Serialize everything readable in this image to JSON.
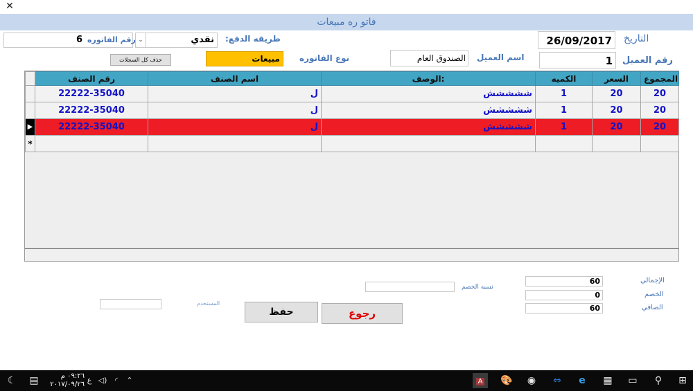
{
  "window": {
    "title": "فاتو ره مبيعات",
    "close_glyph": "✕"
  },
  "form": {
    "date_label": "التاريخ",
    "date_value": "26/09/2017",
    "payment_label": "طريقه الدفع:",
    "payment_value": "نقدي",
    "invoice_num_label": "رقم الفاتوره",
    "invoice_num_value": "6",
    "customer_num_label": "رقم العميل",
    "customer_num_value": "1",
    "customer_name_label": "اسم العميل",
    "customer_name_value": "الصندوق العام",
    "invoice_type_label": "نوع الفاتوره",
    "invoice_type_value": "مبيعات",
    "invoice_type_color": "#ffc000",
    "delete_all_label": "حذف كل السجلات"
  },
  "grid": {
    "header_color": "#42a5c4",
    "selected_color": "#ee1c25",
    "columns": [
      "المجموع",
      "السعر",
      "الكميه",
      "الوصف:",
      "اسم الصنف",
      "رقم الصنف"
    ],
    "rows": [
      {
        "total": "20",
        "price": "20",
        "qty": "1",
        "desc": "ششششش",
        "name": "ل",
        "code": "22222-35040",
        "marker": ""
      },
      {
        "total": "20",
        "price": "20",
        "qty": "1",
        "desc": "ششششش",
        "name": "ل",
        "code": "22222-35040",
        "marker": ""
      },
      {
        "total": "20",
        "price": "20",
        "qty": "1",
        "desc": "ششششش",
        "name": "ل",
        "code": "22222-35040",
        "marker": "▶"
      }
    ],
    "new_row_marker": "*"
  },
  "totals": {
    "gross_label": "الإجمالي",
    "gross_value": "60",
    "discount_label": "الخصم",
    "discount_value": "0",
    "net_label": "الصافي",
    "net_value": "60",
    "discount_pct_label": "نسبه الخصم",
    "discount_pct_value": "",
    "user_label": "المستخدم",
    "user_value": ""
  },
  "buttons": {
    "save": "حفظ",
    "back": "رجوع",
    "back_color": "#e00000"
  },
  "taskbar": {
    "time": "٠٩:٢٦ م",
    "date": "٢٠١٧/٠٩/٢٦",
    "lang": "ع",
    "icons": [
      "moon-icon",
      "notification-icon",
      "volume-icon",
      "wifi-icon",
      "chevron-up-icon",
      "access-icon",
      "paint-icon",
      "people-icon",
      "teamviewer-icon",
      "ie-icon",
      "store-icon",
      "task-view-icon",
      "search-icon",
      "windows-icon"
    ]
  }
}
